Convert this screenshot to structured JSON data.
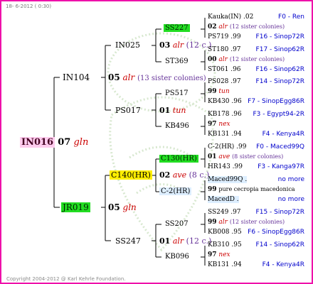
{
  "header": "18- 6-2012 ( 0:30)",
  "footer": "Copyright 2004-2012 @ Karl Kehrle Foundation.",
  "root": {
    "id": "IN016",
    "gen": "07",
    "race": "gln"
  },
  "gen1": [
    {
      "key": "in104",
      "id": "IN104",
      "gen": "05",
      "race": "alr",
      "sisters": "(13 sister colonies)"
    },
    {
      "key": "jr019",
      "id": "JR019",
      "gen": "05",
      "race": "gln"
    }
  ],
  "gen2": [
    {
      "key": "in025",
      "id": "IN025",
      "gen": "03",
      "race": "alr",
      "sisters": "(12 c.)"
    },
    {
      "key": "ps017",
      "id": "PS017",
      "gen": "01",
      "race": "tun"
    },
    {
      "key": "c140",
      "id": "C140(HR)",
      "gen": "02",
      "race": "ave",
      "sisters": "(8 c.)"
    },
    {
      "key": "ss247",
      "id": "SS247",
      "gen": "01",
      "race": "alr",
      "sisters": "(12 c.)"
    }
  ],
  "gen3": [
    "SS227",
    "ST369",
    "PS517",
    "KB496",
    "C130(HR)",
    "C-2(HR)",
    "SS207",
    "KB096"
  ],
  "gen4": [
    {
      "drone": "Kauka(IN) .02",
      "gen": "02",
      "race": "alr",
      "sisters": "(12 sister colonies)",
      "mother": "PS719 .99",
      "loc_d": "F0 - Ren",
      "loc_m": "F16 - Sinop72R"
    },
    {
      "drone": "ST180 .97",
      "gen": "00",
      "race": "alr",
      "sisters": "(12 sister colonies)",
      "mother": "ST061 .96",
      "loc_d": "F17 - Sinop62R",
      "loc_m": "F16 - Sinop62R"
    },
    {
      "drone": "PS028 .97",
      "gen": "99",
      "race": "tun",
      "sisters": "",
      "mother": "KB430 .96",
      "loc_d": "F14 - Sinop72R",
      "loc_m": "F7 - SinopEgg86R"
    },
    {
      "drone": "KB178 .96",
      "gen": "97",
      "race": "nex",
      "sisters": "",
      "mother": "KB131 .94",
      "loc_d": "F3 - Egypt94-2R",
      "loc_m": "F4 - Kenya4R"
    },
    {
      "drone": "C-2(HR) .99",
      "gen": "01",
      "race": "ave",
      "sisters": "(8 sister colonies)",
      "mother": "HR143 .99",
      "loc_d": "F0 - Maced99Q",
      "loc_m": "F3 - Kanga97R"
    },
    {
      "drone": "Maced99Q .",
      "gen": "99",
      "race": "pure cecropia macedonica",
      "sisters": "",
      "mother": "MacedD .",
      "loc_d": "no more",
      "loc_m": "no more"
    },
    {
      "drone": "SS249 .97",
      "gen": "99",
      "race": "alr",
      "sisters": "(12 sister colonies)",
      "mother": "KB008 .95",
      "loc_d": "F15 - Sinop72R",
      "loc_m": "F6 - SinopEgg86R"
    },
    {
      "drone": "KB310 .95",
      "gen": "97",
      "race": "nex",
      "sisters": "",
      "mother": "KB131 .94",
      "loc_d": "F14 - Sinop62R",
      "loc_m": "F4 - Kenya4R"
    }
  ]
}
